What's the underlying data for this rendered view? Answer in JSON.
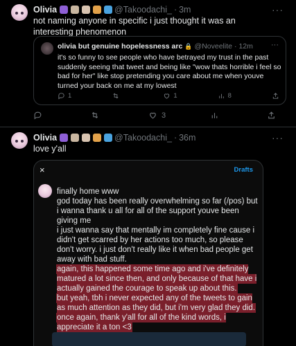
{
  "tweet1": {
    "author": {
      "name": "Olivia",
      "handle": "@Takoodachi_",
      "time": "3m"
    },
    "emojis": [
      "#8e5fd6",
      "#c9b6a0",
      "#d8c3b0",
      "#e3a24a",
      "#4aa3df"
    ],
    "text": "not naming anyone in specific i just thought it was an interesting phenomenon",
    "quote": {
      "name": "olivia but genuine hopelessness arc",
      "lock": "🔒",
      "handle": "@Noveelite",
      "time": "12m",
      "text": "it's so funny to see people who have betrayed my trust in the past suddenly seeing that tweet and being like \"wow thats horrible i feel so bad for her\" like stop pretending you care about me when youve turned your back on me at my lowest",
      "actions": {
        "reply": "1",
        "retweet": "",
        "like": "1",
        "views": "8"
      }
    },
    "actions": {
      "reply": "",
      "retweet": "",
      "like": "3",
      "views": ""
    }
  },
  "tweet2": {
    "author": {
      "name": "Olivia",
      "handle": "@Takoodachi_",
      "time": "36m"
    },
    "emojis": [
      "#8e5fd6",
      "#c9b6a0",
      "#d8c3b0",
      "#e3a24a",
      "#4aa3df"
    ],
    "text": "love y'all",
    "drafts_card": {
      "close_icon": "×",
      "drafts_label": "Drafts",
      "lines": [
        {
          "text": "finally home www",
          "highlight": false
        },
        {
          "text": "god today has been really overwhelming so far (/pos) but i wanna thank u all for all of the support youve been giving me",
          "highlight": false
        },
        {
          "text": "i just wanna say that mentally im completely fine cause i didn't get scarred by her actions too much, so please don't worry. i just don't really like it when bad people get away with bad stuff.",
          "highlight": false
        },
        {
          "text": "again, this happened some time ago and i've definitely matured a lot since then, and only because of that have i actually gained the courage to speak up about this.",
          "highlight": true
        },
        {
          "text": "but yeah, tbh i never expected any of the tweets to gain as much attention as they did, but i'm very glad they did.",
          "highlight": true
        },
        {
          "text": "once again, thank y'all for all of the kind words, i appreciate it a ton <3",
          "highlight": true
        }
      ]
    }
  },
  "colors": {
    "background": "#000000",
    "accent": "#1d9bf0",
    "muted": "#71767b",
    "highlight": "#7a1f2b"
  },
  "icons": {
    "more": "more-dots-icon",
    "reply": "reply-icon",
    "retweet": "retweet-icon",
    "like": "heart-icon",
    "views": "views-icon",
    "share": "share-icon"
  }
}
